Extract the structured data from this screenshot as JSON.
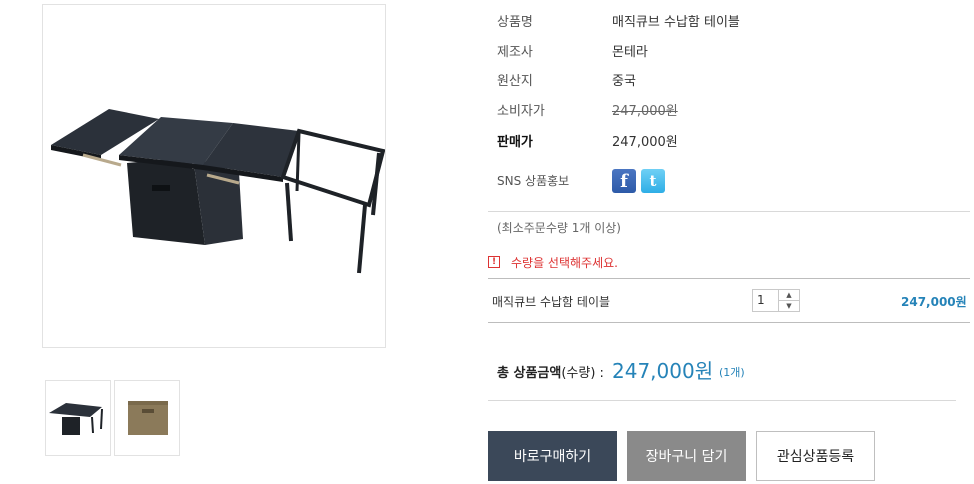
{
  "product": {
    "name_label": "상품명",
    "name_value": "매직큐브 수납함 테이블",
    "maker_label": "제조사",
    "maker_value": "몬테라",
    "origin_label": "원산지",
    "origin_value": "중국",
    "consumer_price_label": "소비자가",
    "consumer_price_value": "247,000원",
    "sale_price_label": "판매가",
    "sale_price_value": "247,000원",
    "sns_label": "SNS 상품홍보",
    "sns_icons": [
      "facebook-icon",
      "twitter-icon"
    ]
  },
  "min_order_note": "(최소주문수량 1개 이상)",
  "warning_text": "수량을 선택해주세요.",
  "option_row": {
    "item_name": "매직큐브 수납함 테이블",
    "quantity": "1",
    "price": "247,000원"
  },
  "total": {
    "label_bold": "총 상품금액",
    "label_suffix": "(수량) :",
    "value": "247,000원",
    "count": "(1개)"
  },
  "buttons": {
    "buy": "바로구매하기",
    "cart": "장바구니 담기",
    "wish": "관심상품등록"
  },
  "colors": {
    "accent_blue": "#2583b8",
    "buy_button": "#3b4859",
    "cart_button": "#8a8a8a",
    "warning_red": "#dd3333"
  }
}
